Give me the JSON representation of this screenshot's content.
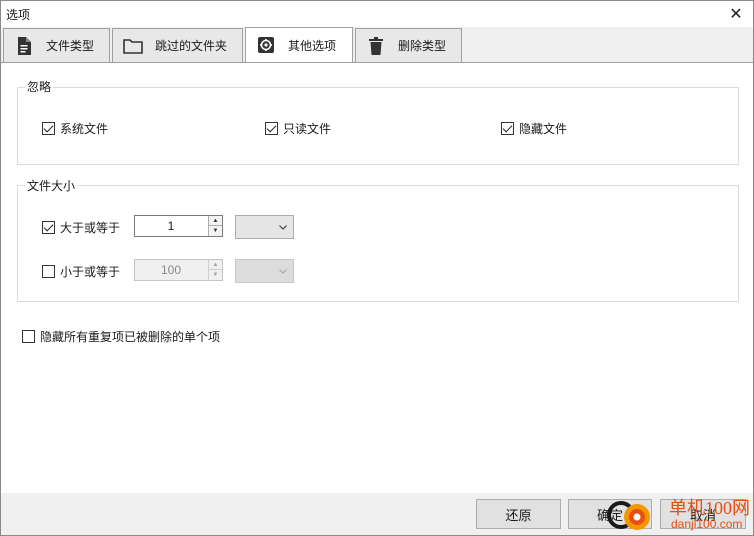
{
  "window": {
    "title": "选项"
  },
  "tabs": [
    {
      "label": "文件类型",
      "icon": "document-icon",
      "active": false
    },
    {
      "label": "跳过的文件夹",
      "icon": "folder-icon",
      "active": false
    },
    {
      "label": "其他选项",
      "icon": "gear-icon",
      "active": true
    },
    {
      "label": "删除类型",
      "icon": "trash-icon",
      "active": false
    }
  ],
  "ignore_group": {
    "title": "忽略",
    "options": [
      {
        "label": "系统文件",
        "checked": true
      },
      {
        "label": "只读文件",
        "checked": true
      },
      {
        "label": "隐藏文件",
        "checked": true
      }
    ]
  },
  "size_group": {
    "title": "文件大小",
    "min": {
      "label": "大于或等于",
      "checked": true,
      "value": "1",
      "unit": ""
    },
    "max": {
      "label": "小于或等于",
      "checked": false,
      "value": "100",
      "unit": ""
    }
  },
  "hide_single": {
    "label": "隐藏所有重复项已被删除的单个项",
    "checked": false
  },
  "buttons": {
    "restore": "还原",
    "ok": "确定",
    "cancel": "取消"
  },
  "watermark": {
    "line1": "单机100网",
    "line2": "danji100.com"
  }
}
